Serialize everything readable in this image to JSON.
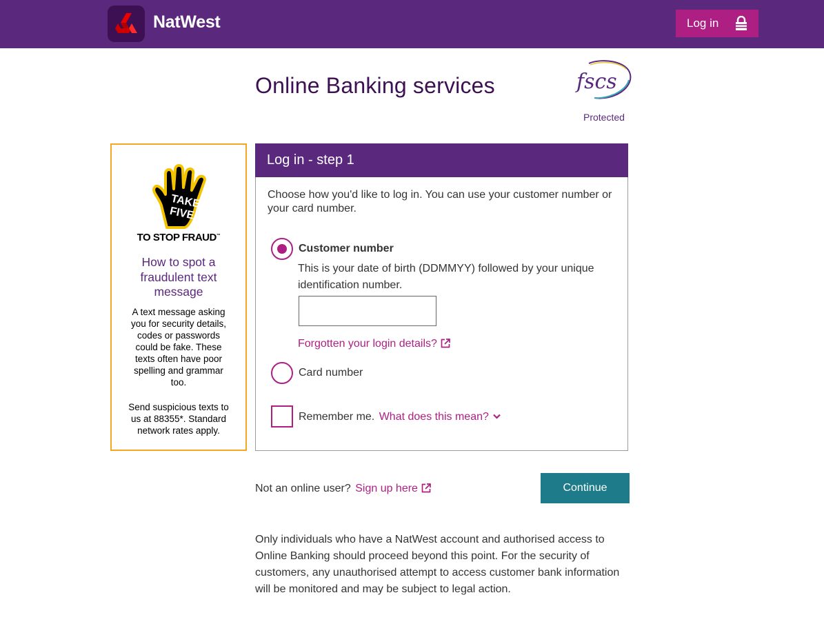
{
  "header": {
    "brand": "NatWest",
    "login_label": "Log in"
  },
  "page": {
    "title": "Online Banking services",
    "fscs_protected": "Protected",
    "fscs_logo_text": "fscs"
  },
  "fraud_panel": {
    "badge_line1": "TAKE",
    "badge_line2": "FIVE",
    "badge_tagline": "TO STOP FRAUD",
    "trademark": "™",
    "heading": "How to spot a fraudulent text message",
    "body1": "A text message asking you for security details, codes or passwords could be fake. These texts often have poor spelling and grammar too.",
    "body2": "Send suspicious texts to us at 88355*. Standard network rates apply."
  },
  "login_step": {
    "title": "Log in - step 1",
    "intro": "Choose how you'd like to log in. You can use your customer number or your card number.",
    "options": [
      {
        "label": "Customer number",
        "selected": true,
        "help": "This is your date of birth (DDMMYY) followed by your unique identification number.",
        "input_value": ""
      },
      {
        "label": "Card number",
        "selected": false
      }
    ],
    "forgot_link": "Forgotten your login details?",
    "remember_label": "Remember me.",
    "remember_checked": false,
    "what_link": "What does this mean?"
  },
  "footer": {
    "not_user": "Not an online user?",
    "signup_link": "Sign up here",
    "continue_label": "Continue",
    "disclaimer": "Only individuals who have a NatWest account and authorised access to Online Banking should proceed beyond this point. For the security of customers, any unauthorised attempt to access customer bank information will be monitored and may be subject to legal action."
  },
  "colors": {
    "header_purple": "#5a287d",
    "accent_magenta": "#ad1f82",
    "continue_teal": "#1d7b8a",
    "fraud_border": "#f5a623",
    "logo_red": "#e90000"
  },
  "icons": {
    "logo": "natwest-chevron-logo-icon",
    "lock": "lock-icon",
    "external": "external-link-icon",
    "chevron": "chevron-down-icon",
    "hand": "take-five-hand-icon"
  }
}
